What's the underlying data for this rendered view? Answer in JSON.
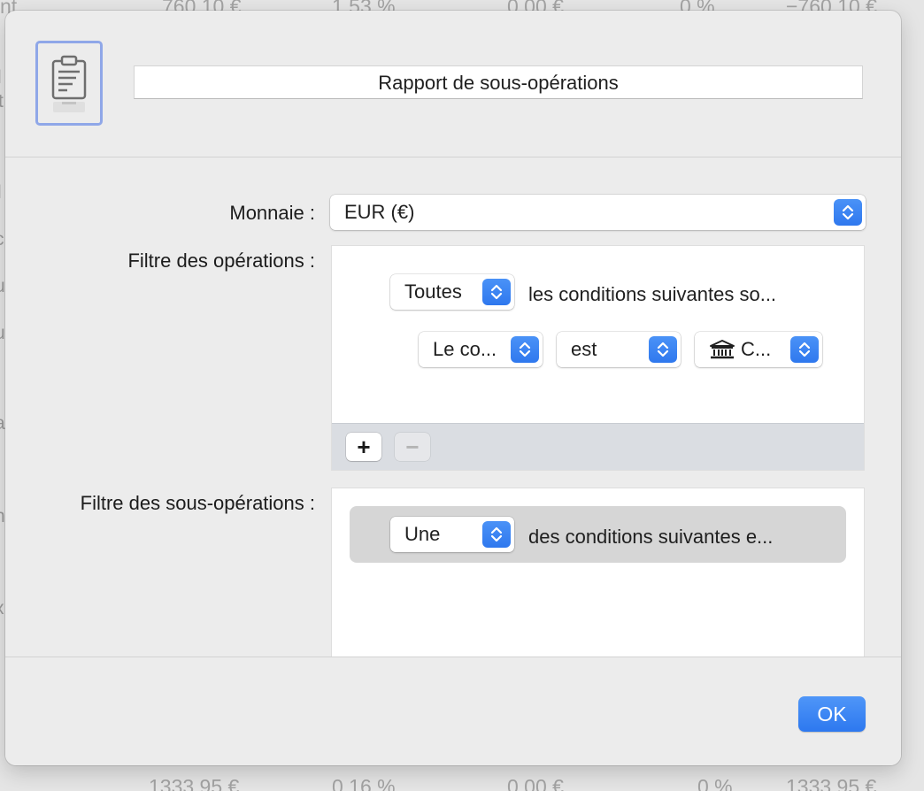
{
  "background": {
    "top_row": [
      "nt",
      "760,10 €",
      "1,53 %",
      "0,00 €",
      "0 %",
      "−760,10 €"
    ],
    "bottom_row": [
      "1333,95 €",
      "0,16 %",
      "0,00 €",
      "0 %",
      "1333,95 €"
    ],
    "left_fragments": [
      "l",
      "t",
      "l",
      "c",
      "u",
      "u",
      "a",
      "n",
      "x"
    ]
  },
  "header": {
    "icon": "clipboard-report-icon",
    "title": "Rapport de sous-opérations"
  },
  "currency": {
    "label": "Monnaie :",
    "value": "EUR (€)"
  },
  "transaction_filter": {
    "label": "Filtre des opérations :",
    "match_value": "Toutes",
    "match_text": "les conditions suivantes so...",
    "rule": {
      "field": "Le co...",
      "operator": "est",
      "value_icon": "bank-icon",
      "value": "C..."
    },
    "add_label": "+",
    "remove_label": "−"
  },
  "split_filter": {
    "label": "Filtre des sous-opérations :",
    "match_value": "Une",
    "match_text": "des conditions suivantes e..."
  },
  "footer": {
    "ok_label": "OK"
  },
  "colors": {
    "accent": "#3380f3",
    "icon_well_border": "#8fa7e8"
  }
}
